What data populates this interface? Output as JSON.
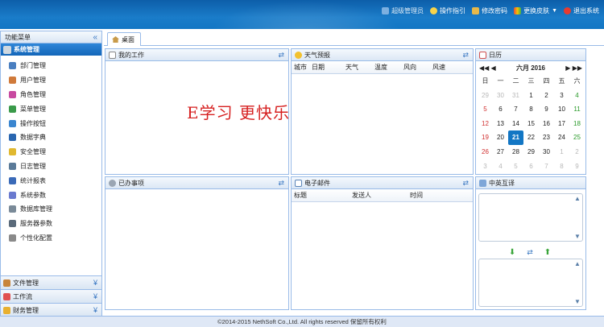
{
  "topnav": {
    "user": "超级管理员",
    "guide": "操作指引",
    "password": "修改密码",
    "skin": "更换皮肤",
    "logout": "退出系统"
  },
  "sidebar": {
    "title": "功能菜单",
    "collapse_icon": "double-chevron-left-icon",
    "active_group": "系统管理",
    "items": [
      {
        "label": "部门管理",
        "icon": "department-icon"
      },
      {
        "label": "用户管理",
        "icon": "user-icon"
      },
      {
        "label": "角色管理",
        "icon": "role-icon"
      },
      {
        "label": "菜单管理",
        "icon": "menu-tree-icon"
      },
      {
        "label": "操作按钮",
        "icon": "cube-icon"
      },
      {
        "label": "数据字典",
        "icon": "dictionary-icon"
      },
      {
        "label": "安全管理",
        "icon": "shield-icon"
      },
      {
        "label": "日志管理",
        "icon": "log-icon"
      },
      {
        "label": "统计报表",
        "icon": "chart-icon"
      },
      {
        "label": "系统参数",
        "icon": "params-icon"
      },
      {
        "label": "数据库管理",
        "icon": "database-icon"
      },
      {
        "label": "服务器参数",
        "icon": "server-icon"
      },
      {
        "label": "个性化配置",
        "icon": "gear-icon"
      }
    ],
    "groups": [
      {
        "label": "文件管理",
        "icon": "file-icon"
      },
      {
        "label": "工作流",
        "icon": "workflow-icon"
      },
      {
        "label": "财务管理",
        "icon": "finance-icon"
      }
    ]
  },
  "tabs": [
    {
      "label": "桌面",
      "icon": "home-icon"
    }
  ],
  "panels": {
    "my_work": {
      "title": "我的工作"
    },
    "weather": {
      "title": "天气预报",
      "columns": [
        "城市",
        "日期",
        "天气",
        "温度",
        "风向",
        "风速"
      ]
    },
    "calendar": {
      "title": "日历",
      "month_label": "六月 2016",
      "weekdays": [
        "日",
        "一",
        "二",
        "三",
        "四",
        "五",
        "六"
      ],
      "weeks": [
        [
          {
            "d": "29",
            "t": "other-sun"
          },
          {
            "d": "30",
            "t": "other"
          },
          {
            "d": "31",
            "t": "other"
          },
          {
            "d": "1"
          },
          {
            "d": "2"
          },
          {
            "d": "3"
          },
          {
            "d": "4",
            "t": "sat"
          }
        ],
        [
          {
            "d": "5",
            "t": "sun"
          },
          {
            "d": "6"
          },
          {
            "d": "7"
          },
          {
            "d": "8"
          },
          {
            "d": "9"
          },
          {
            "d": "10"
          },
          {
            "d": "11",
            "t": "sat"
          }
        ],
        [
          {
            "d": "12",
            "t": "sun"
          },
          {
            "d": "13"
          },
          {
            "d": "14"
          },
          {
            "d": "15"
          },
          {
            "d": "16"
          },
          {
            "d": "17"
          },
          {
            "d": "18",
            "t": "sat"
          }
        ],
        [
          {
            "d": "19",
            "t": "sun"
          },
          {
            "d": "20"
          },
          {
            "d": "21",
            "t": "today"
          },
          {
            "d": "22"
          },
          {
            "d": "23"
          },
          {
            "d": "24"
          },
          {
            "d": "25",
            "t": "sat"
          }
        ],
        [
          {
            "d": "26",
            "t": "sun"
          },
          {
            "d": "27"
          },
          {
            "d": "28"
          },
          {
            "d": "29"
          },
          {
            "d": "30"
          },
          {
            "d": "1",
            "t": "other"
          },
          {
            "d": "2",
            "t": "other-sat"
          }
        ],
        [
          {
            "d": "3",
            "t": "other"
          },
          {
            "d": "4",
            "t": "other"
          },
          {
            "d": "5",
            "t": "other"
          },
          {
            "d": "6",
            "t": "other"
          },
          {
            "d": "7",
            "t": "other"
          },
          {
            "d": "8",
            "t": "other"
          },
          {
            "d": "9",
            "t": "other"
          }
        ]
      ]
    },
    "slogan": "E学习 更快乐",
    "done": {
      "title": "已办事项"
    },
    "email": {
      "title": "电子邮件",
      "columns": [
        "标题",
        "发送人",
        "时间"
      ]
    },
    "translate": {
      "title": "中英互译"
    }
  },
  "footer": "©2014-2015 NethSoft Co.,Ltd. All rights reserved 保留所有权利"
}
